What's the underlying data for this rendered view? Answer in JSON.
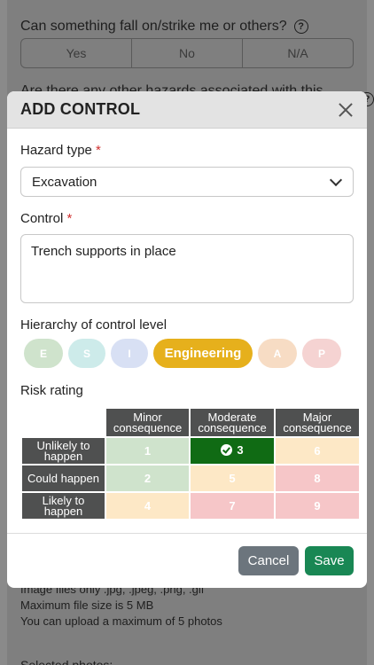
{
  "background": {
    "question1": "Can something fall on/strike me or others?",
    "options": [
      "Yes",
      "No",
      "N/A"
    ],
    "question2": "Are there any other hazards associated with this task?",
    "help_glyph": "?",
    "info_lines": [
      "Image files only .jpg, .jpeg, .png, .gif",
      "Maximum file size is 5 MB",
      "You can upload a maximum of 5 photos"
    ],
    "selected_photos_label": "Selected photos:"
  },
  "modal": {
    "title": "ADD CONTROL",
    "hazard_type_label": "Hazard type",
    "required_marker": "*",
    "hazard_type_value": "Excavation",
    "control_label": "Control",
    "control_value": "Trench supports in place",
    "hierarchy_label": "Hierarchy of control level",
    "hierarchy_levels": [
      "E",
      "S",
      "I",
      "Engineering",
      "A",
      "P"
    ],
    "hierarchy_selected": "Engineering",
    "risk_label": "Risk rating",
    "risk_columns": [
      "Minor consequence",
      "Moderate consequence",
      "Major consequence"
    ],
    "risk_rows": [
      {
        "label": "Unlikely to happen",
        "values": [
          "1",
          "3",
          "6"
        ]
      },
      {
        "label": "Could happen",
        "values": [
          "2",
          "5",
          "8"
        ]
      },
      {
        "label": "Likely to happen",
        "values": [
          "4",
          "7",
          "9"
        ]
      }
    ],
    "risk_selected": "3",
    "cancel_label": "Cancel",
    "save_label": "Save"
  },
  "colors": {
    "selected_hierarchy": "#e6b01c",
    "selected_risk": "#106b14",
    "save_button": "#198754",
    "cancel_button": "#6c757d"
  }
}
